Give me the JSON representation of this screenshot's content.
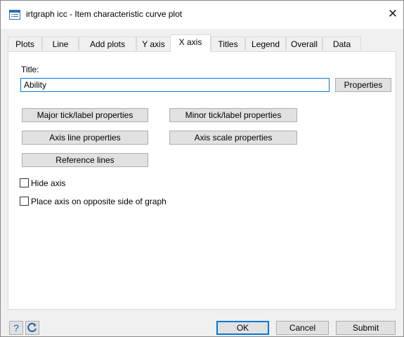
{
  "window": {
    "title": "irtgraph icc - Item characteristic curve plot",
    "close_glyph": "✕"
  },
  "icons": {
    "app": "dialog-window-icon",
    "close": "close-icon",
    "help": "help-question-icon",
    "reset": "refresh-reset-icon"
  },
  "tabs": [
    {
      "label": "Plots"
    },
    {
      "label": "Line"
    },
    {
      "label": "Add plots"
    },
    {
      "label": "Y axis"
    },
    {
      "label": "X axis"
    },
    {
      "label": "Titles"
    },
    {
      "label": "Legend"
    },
    {
      "label": "Overall"
    },
    {
      "label": "Data"
    }
  ],
  "active_tab": "X axis",
  "xaxis": {
    "title_label": "Title:",
    "title_value": "Ability",
    "properties_label": "Properties",
    "major_tick_label": "Major tick/label properties",
    "minor_tick_label": "Minor tick/label properties",
    "axis_line_label": "Axis line properties",
    "axis_scale_label": "Axis scale properties",
    "reference_lines_label": "Reference lines",
    "hide_axis_label": "Hide axis",
    "hide_axis_checked": false,
    "opposite_side_label": "Place axis on opposite side of graph",
    "opposite_side_checked": false
  },
  "footer": {
    "help_glyph": "?",
    "ok_label": "OK",
    "cancel_label": "Cancel",
    "submit_label": "Submit"
  },
  "colors": {
    "accent": "#0078d7",
    "icon_blue": "#2f6fb5",
    "button_face": "#e1e1e1",
    "dialog_bg": "#f0f0f0"
  }
}
